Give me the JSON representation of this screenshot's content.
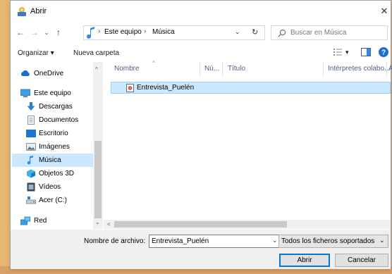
{
  "window": {
    "title": "Abrir",
    "close_glyph": "✕"
  },
  "nav": {
    "back_glyph": "←",
    "forward_glyph": "→",
    "recent_glyph": "⌄",
    "up_glyph": "↑",
    "breadcrumb": [
      "Este equipo",
      "Música"
    ],
    "separator": "›",
    "address_dropdown_glyph": "⌄",
    "refresh_glyph": "↻",
    "search_placeholder": "Buscar en Música"
  },
  "toolbar": {
    "organize_label": "Organizar ▾",
    "new_folder_label": "Nueva carpeta",
    "view_dropdown_glyph": "▾"
  },
  "sidebar": {
    "items": [
      {
        "label": "OneDrive",
        "icon": "cloud-icon"
      },
      {
        "label": "Este equipo",
        "icon": "computer-icon"
      },
      {
        "label": "Descargas",
        "icon": "download-icon"
      },
      {
        "label": "Documentos",
        "icon": "document-icon"
      },
      {
        "label": "Escritorio",
        "icon": "desktop-icon"
      },
      {
        "label": "Imágenes",
        "icon": "images-icon"
      },
      {
        "label": "Música",
        "icon": "music-icon",
        "selected": true
      },
      {
        "label": "Objetos 3D",
        "icon": "cube-icon"
      },
      {
        "label": "Vídeos",
        "icon": "video-icon"
      },
      {
        "label": "Acer (C:)",
        "icon": "drive-icon"
      },
      {
        "label": "Red",
        "icon": "network-icon"
      }
    ],
    "scroll_up_glyph": "^",
    "scroll_down_glyph": "⌄"
  },
  "files": {
    "columns": [
      "Nombre",
      "Nú...",
      "Título",
      "Intérpretes colabo...",
      "Á"
    ],
    "sort_glyph": "^",
    "rows": [
      {
        "name": "Entrevista_Puelén",
        "icon": "audio-file-icon",
        "selected": true
      }
    ],
    "hscroll_left_glyph": "<"
  },
  "footer": {
    "filename_label": "Nombre de archivo:",
    "filename_value": "Entrevista_Puelén",
    "filename_dropdown_glyph": "⌄",
    "filter_value": "Todos los ficheros soportados",
    "filter_dropdown_glyph": "⌄",
    "open_label": "Abrir",
    "cancel_label": "Cancelar"
  },
  "colors": {
    "accent": "#0078d7",
    "selection": "#cce8ff",
    "header_text": "#4d6082"
  }
}
